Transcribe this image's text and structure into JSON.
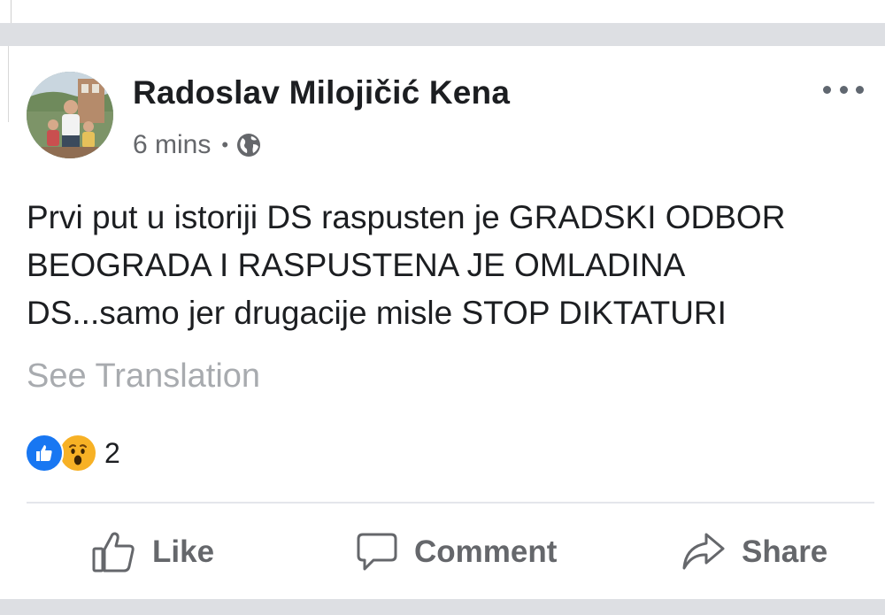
{
  "post": {
    "author": "Radoslav Milojičić Kena",
    "time": "6 mins",
    "separator": "•",
    "privacy_icon": "globe-icon",
    "text_lines": [
      "Prvi put u istoriji DS raspusten je GRADSKI ODBOR",
      "BEOGRADA I RASPUSTENA JE OMLADINA",
      "DS...samo jer drugacije misle STOP DIKTATURI"
    ],
    "translation_link": "See Translation",
    "reactions": {
      "icons": [
        "like-reaction-icon",
        "wow-reaction-icon"
      ],
      "count": "2"
    }
  },
  "actions": {
    "like": "Like",
    "comment": "Comment",
    "share": "Share"
  },
  "colors": {
    "background": "#dddfe3",
    "card": "#ffffff",
    "text": "#1c1e21",
    "muted": "#65676b",
    "translation": "#a8abaf",
    "like_blue": "#1877f2",
    "wow_yellow": "#f7b125"
  }
}
